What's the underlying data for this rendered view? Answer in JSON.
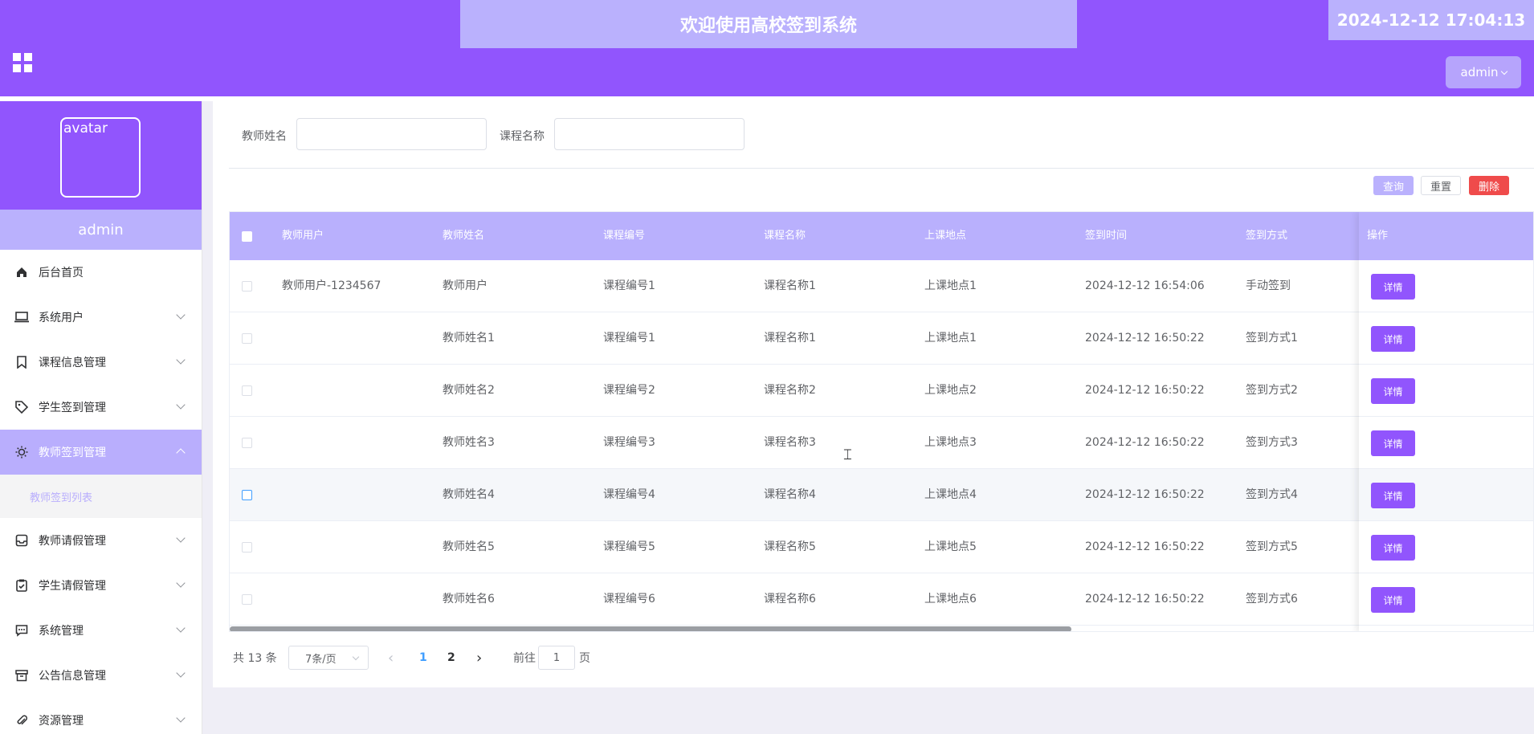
{
  "header": {
    "title": "欢迎使用高校签到系统",
    "datetime": "2024-12-12 17:04:13",
    "user_button": "admin"
  },
  "sidebar": {
    "avatar_alt": "avatar",
    "username": "admin",
    "items": [
      {
        "label": "后台首页",
        "icon": "home-icon"
      },
      {
        "label": "系统用户",
        "icon": "laptop-icon"
      },
      {
        "label": "课程信息管理",
        "icon": "bookmark-icon"
      },
      {
        "label": "学生签到管理",
        "icon": "tag-icon"
      },
      {
        "label": "教师签到管理",
        "icon": "sun-icon"
      },
      {
        "label": "教师请假管理",
        "icon": "inbox-icon"
      },
      {
        "label": "学生请假管理",
        "icon": "clipboard-icon"
      },
      {
        "label": "系统管理",
        "icon": "message-icon"
      },
      {
        "label": "公告信息管理",
        "icon": "archive-icon"
      },
      {
        "label": "资源管理",
        "icon": "paperclip-icon"
      }
    ],
    "submenu": {
      "label": "教师签到列表"
    }
  },
  "search": {
    "teacher_name_label": "教师姓名",
    "teacher_name_value": "",
    "course_name_label": "课程名称",
    "course_name_value": ""
  },
  "toolbar": {
    "query": "查询",
    "reset": "重置",
    "delete": "删除"
  },
  "table": {
    "headers": [
      "教师用户",
      "教师姓名",
      "课程编号",
      "课程名称",
      "上课地点",
      "签到时间",
      "签到方式",
      "操作"
    ],
    "detail_label": "详情",
    "rows": [
      {
        "teacher_user": "教师用户-1234567",
        "teacher_name": "教师用户",
        "course_no": "课程编号1",
        "course_name": "课程名称1",
        "location": "上课地点1",
        "time": "2024-12-12 16:54:06",
        "method": "手动签到"
      },
      {
        "teacher_user": "",
        "teacher_name": "教师姓名1",
        "course_no": "课程编号1",
        "course_name": "课程名称1",
        "location": "上课地点1",
        "time": "2024-12-12 16:50:22",
        "method": "签到方式1"
      },
      {
        "teacher_user": "",
        "teacher_name": "教师姓名2",
        "course_no": "课程编号2",
        "course_name": "课程名称2",
        "location": "上课地点2",
        "time": "2024-12-12 16:50:22",
        "method": "签到方式2"
      },
      {
        "teacher_user": "",
        "teacher_name": "教师姓名3",
        "course_no": "课程编号3",
        "course_name": "课程名称3",
        "location": "上课地点3",
        "time": "2024-12-12 16:50:22",
        "method": "签到方式3"
      },
      {
        "teacher_user": "",
        "teacher_name": "教师姓名4",
        "course_no": "课程编号4",
        "course_name": "课程名称4",
        "location": "上课地点4",
        "time": "2024-12-12 16:50:22",
        "method": "签到方式4"
      },
      {
        "teacher_user": "",
        "teacher_name": "教师姓名5",
        "course_no": "课程编号5",
        "course_name": "课程名称5",
        "location": "上课地点5",
        "time": "2024-12-12 16:50:22",
        "method": "签到方式5"
      },
      {
        "teacher_user": "",
        "teacher_name": "教师姓名6",
        "course_no": "课程编号6",
        "course_name": "课程名称6",
        "location": "上课地点6",
        "time": "2024-12-12 16:50:22",
        "method": "签到方式6"
      }
    ]
  },
  "pagination": {
    "total": "共 13 条",
    "page_size": "7条/页",
    "prev": "‹",
    "pages": [
      "1",
      "2"
    ],
    "current_page": "1",
    "next": "›",
    "goto_label": "前往",
    "goto_value": "1",
    "page_suffix": "页"
  },
  "colors": {
    "primary": "#9155fd",
    "primary_light": "#bab1fd",
    "danger": "#ef4b4b",
    "link": "#409eff"
  }
}
